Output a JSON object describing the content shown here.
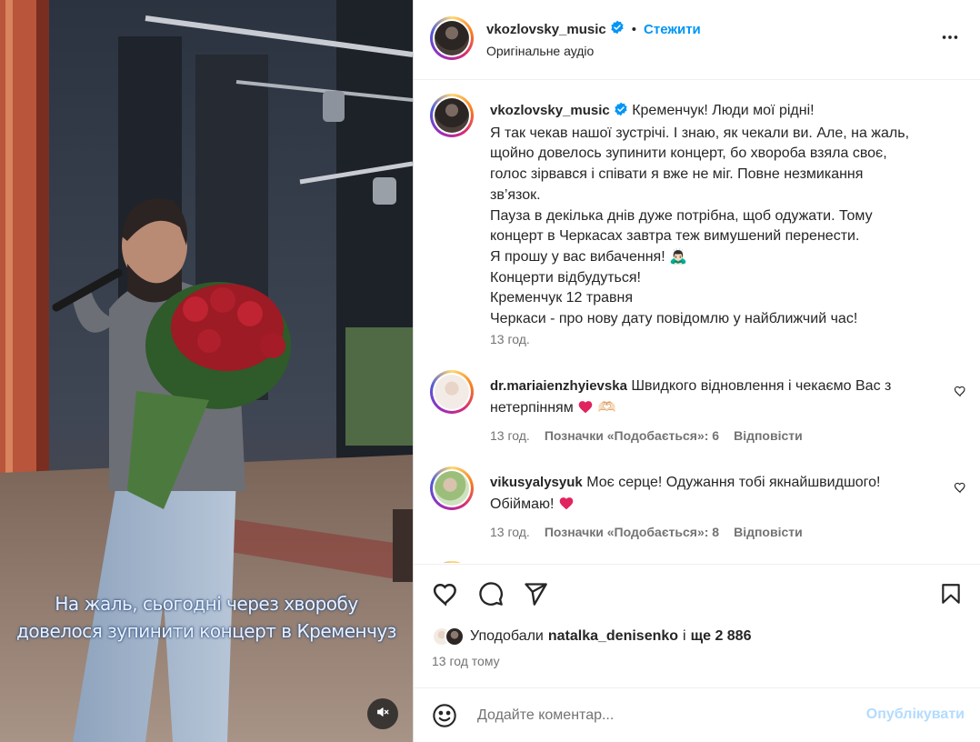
{
  "post": {
    "username": "vkozlovsky_music",
    "follow_label": "Стежити",
    "separator": "•",
    "audio_label": "Оригінальне аудіо",
    "video_caption_line1": "На жаль, сьогодні через хворобу",
    "video_caption_line2": "довелося зупинити концерт в Кременчуз"
  },
  "caption": {
    "username": "vkozlovsky_music",
    "lines": [
      "Кременчук! Люди мої рідні!",
      "Я так чекав нашої зустрічі. І знаю, як чекали ви. Але, на жаль,",
      "щойно довелось зупинити концерт, бо хвороба взяла своє,",
      "голос зірвався і співати я вже не міг. Повне незмикання",
      "зв’язок.",
      "Пауза в декілька днів дуже потрібна, щоб одужати. Тому",
      "концерт в Черкасах завтра теж вимушений перенести.",
      "Я прошу у вас вибачення! 🙇🏻‍♂️",
      "Концерти відбудуться!",
      "Кременчук 12 травня",
      "Черкаси - про нову дату повідомлю у найближчий час!"
    ],
    "time": "13 год."
  },
  "comments": [
    {
      "username": "dr.mariaienzhyievska",
      "text_line1": "Швидкого відновлення і чекаємо Вас з",
      "text_line2": "нетерпінням",
      "emoji": "🫶🏻",
      "time": "13 год.",
      "likes": "Позначки «Подобається»: 6",
      "reply": "Відповісти"
    },
    {
      "username": "vikusyalysyuk",
      "text_line1": "Моє серце! Одужання тобі якнайшвидшого!",
      "text_line2": "Обіймаю!",
      "time": "13 год.",
      "likes": "Позначки «Подобається»: 8",
      "reply": "Відповісти"
    }
  ],
  "likes": {
    "prefix": "Уподобали",
    "user": "natalka_denisenko",
    "joiner": "і",
    "rest": "ще 2 886",
    "time": "13 год тому"
  },
  "add_comment": {
    "placeholder": "Додайте коментар...",
    "post_label": "Опублікувати"
  },
  "colors": {
    "accent": "#0095f6",
    "post_disabled": "#b3dbff",
    "heart_red": "#e0245e",
    "muted_text": "#737373"
  },
  "icons": [
    "verified-badge-icon",
    "more-options-icon",
    "heart-icon",
    "comment-icon",
    "share-icon",
    "bookmark-icon",
    "emoji-icon",
    "mute-icon"
  ]
}
